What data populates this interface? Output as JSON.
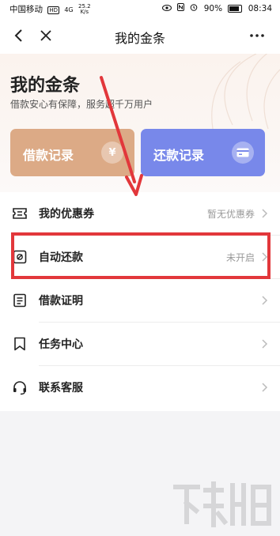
{
  "status_bar": {
    "carrier": "中国移动",
    "hd_badge": "HD",
    "network": "4G",
    "speed_value": "25.2",
    "speed_unit": "K/s",
    "battery": "90%",
    "time": "08:34"
  },
  "nav": {
    "title": "我的金条"
  },
  "hero": {
    "title": "我的金条",
    "subtitle": "借款安心有保障，服务超千万用户"
  },
  "cards": {
    "borrow_label": "借款记录",
    "borrow_icon_glyph": "¥",
    "repay_label": "还款记录"
  },
  "menu": {
    "items": [
      {
        "label": "我的优惠券",
        "status": "暂无优惠券",
        "icon": "coupon-icon"
      },
      {
        "label": "自动还款",
        "status": "未开启",
        "icon": "auto-repay-icon"
      },
      {
        "label": "借款证明",
        "status": "",
        "icon": "document-icon"
      },
      {
        "label": "任务中心",
        "status": "",
        "icon": "bookmark-icon"
      },
      {
        "label": "联系客服",
        "status": "",
        "icon": "headset-icon"
      }
    ]
  },
  "colors": {
    "borrow_card": "#dcaa86",
    "repay_card": "#7888ea",
    "annotation_red": "#e2373b"
  }
}
